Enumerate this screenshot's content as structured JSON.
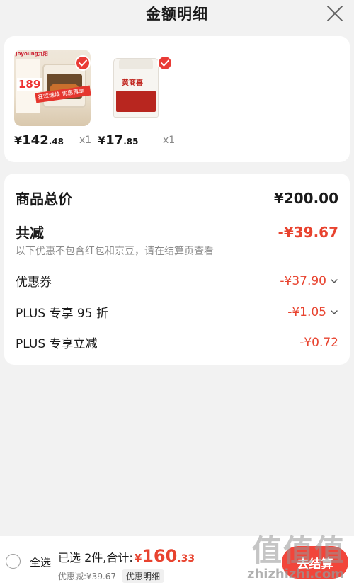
{
  "header": {
    "title": "金额明细"
  },
  "products": [
    {
      "currency": "¥",
      "price_int": "142",
      "price_dec": ".48",
      "qty": "x1",
      "thumb_brand": "Joyoung九阳",
      "thumb_price": "189",
      "thumb_banner": "狂欢继续 优惠再享"
    },
    {
      "currency": "¥",
      "price_int": "17",
      "price_dec": ".85",
      "qty": "x1",
      "thumb_brand": "黄商喜"
    }
  ],
  "summary": {
    "total_label": "商品总价",
    "total_value": "¥200.00",
    "reduce_label": "共减",
    "reduce_value": "-¥39.67",
    "note": "以下优惠不包含红包和京豆，请在结算页查看",
    "coupon_label": "优惠券",
    "coupon_value": "-¥37.90",
    "plus95_label": "PLUS 专享 95 折",
    "plus95_value": "-¥1.05",
    "plusreduce_label": "PLUS 专享立减",
    "plusreduce_value": "-¥0.72"
  },
  "bottom": {
    "select_all": "全选",
    "selected_text": "已选 2件,合计:",
    "total_currency": "¥",
    "total_int": "160",
    "total_dec": ".33",
    "discount_text": "优惠减:¥39.67",
    "detail_label": "优惠明细",
    "checkout_label": "去结算"
  },
  "watermark": {
    "logo": "值值值",
    "url": "zhizhizhi.com"
  },
  "colors": {
    "accent": "#e8432f",
    "button": "#f2453a",
    "background": "#f2f2f2"
  }
}
